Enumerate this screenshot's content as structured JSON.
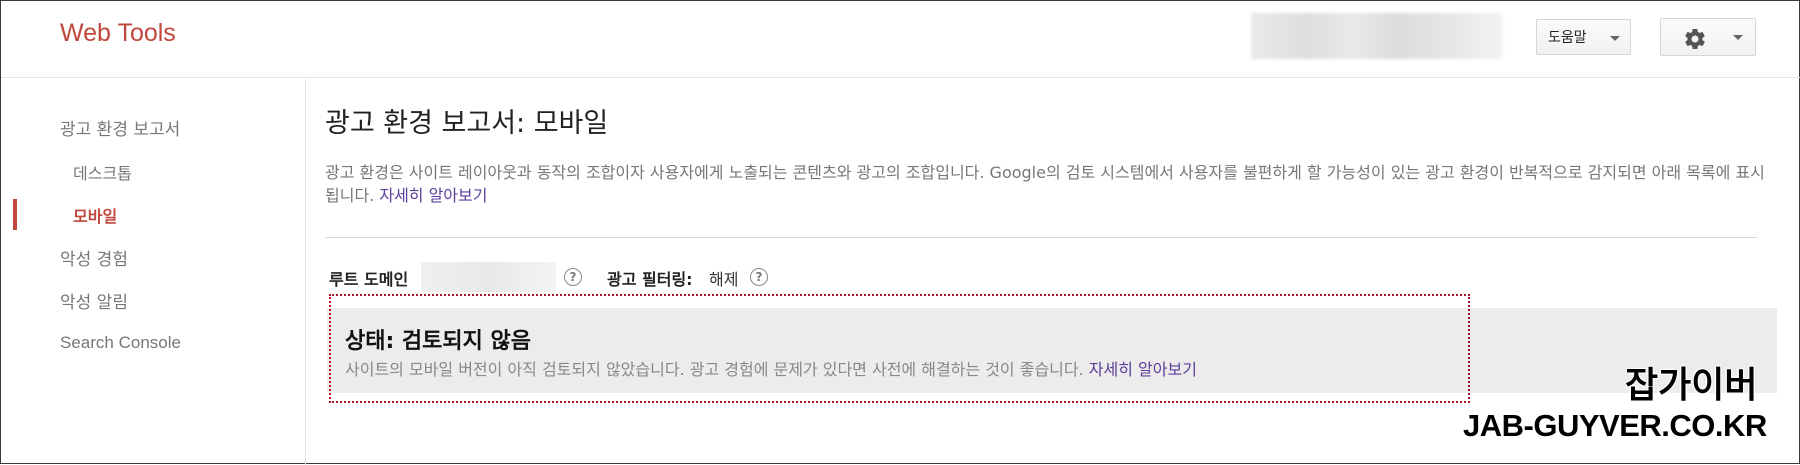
{
  "app": {
    "brand": "Web Tools"
  },
  "header": {
    "help_label": "도움말",
    "settings_icon": "gear-icon"
  },
  "sidebar": {
    "items": [
      {
        "label": "광고 환경 보고서"
      },
      {
        "label": "데스크톱"
      },
      {
        "label": "모바일",
        "active": true
      },
      {
        "label": "악성 경험"
      },
      {
        "label": "악성 알림"
      },
      {
        "label": "Search Console"
      }
    ]
  },
  "main": {
    "title": "광고 환경 보고서: 모바일",
    "description": "광고 환경은 사이트 레이아웃과 동작의 조합이자 사용자에게 노출되는 콘텐츠와 광고의 조합입니다. Google의 검토 시스템에서 사용자를 불편하게 할 가능성이 있는 광고 환경이 반복적으로 감지되면 아래 목록에 표시됩니다.",
    "learn_more": "자세히 알아보기",
    "root_domain_label": "루트 도메인",
    "ad_filtering_label": "광고 필터링:",
    "ad_filtering_value": "해제",
    "help_icon_glyph": "?",
    "status": {
      "title": "상태: 검토되지 않음",
      "description": "사이트의 모바일 버전이 아직 검토되지 않았습니다. 광고 경험에 문제가 있다면 사전에 해결하는 것이 좋습니다.",
      "learn_more": "자세히 알아보기"
    }
  },
  "watermark": {
    "line1": "잡가이버",
    "line2": "JAB-GUYVER.CO.KR"
  },
  "colors": {
    "brand": "#c0473d",
    "link": "#5b3e9a",
    "status_border": "#b0142a"
  }
}
